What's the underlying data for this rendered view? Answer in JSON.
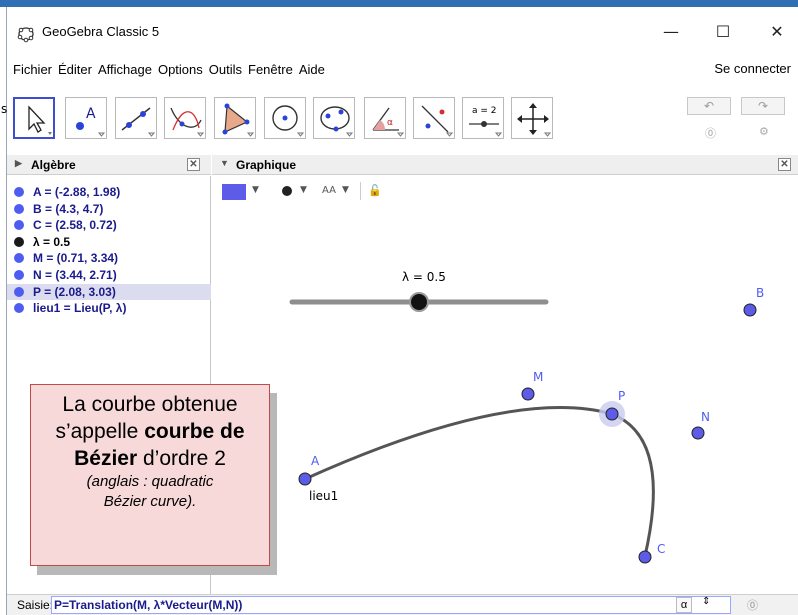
{
  "window": {
    "title": "GeoGebra Classic 5",
    "minimize": "—",
    "maximize": "☐",
    "close": "✕"
  },
  "menu": {
    "items": [
      "Fichier",
      "Éditer",
      "Affichage",
      "Options",
      "Outils",
      "Fenêtre",
      "Aide"
    ],
    "connect": "Se connecter"
  },
  "toolbar": {
    "value_tool_label": "a = 2",
    "undo_icon": "undo-icon",
    "redo_icon": "redo-icon",
    "help_icon": "help-icon",
    "settings_icon": "gear-icon"
  },
  "algebra": {
    "title": "Algèbre",
    "items": [
      {
        "text": "A = (-2.88, 1.98)",
        "color": "#4f5cf0",
        "highlight": false
      },
      {
        "text": "B = (4.3, 4.7)",
        "color": "#4f5cf0",
        "highlight": false
      },
      {
        "text": "C = (2.58, 0.72)",
        "color": "#4f5cf0",
        "highlight": false
      },
      {
        "text": "λ = 0.5",
        "color": "#1a1a1a",
        "highlight": false
      },
      {
        "text": "M = (0.71, 3.34)",
        "color": "#4f5cf0",
        "highlight": false
      },
      {
        "text": "N = (3.44, 2.71)",
        "color": "#4f5cf0",
        "highlight": false
      },
      {
        "text": "P = (2.08, 3.03)",
        "color": "#4f5cf0",
        "highlight": true
      },
      {
        "text": "lieu1 = Lieu(P, λ)",
        "color": "#4f5cf0",
        "highlight": false
      }
    ]
  },
  "graphics": {
    "title": "Graphique",
    "style_bar_text": "AA",
    "slider_label": "λ = 0.5",
    "points": {
      "A": "A",
      "B": "B",
      "C": "C",
      "M": "M",
      "N": "N",
      "P": "P",
      "locus": "lieu1"
    },
    "colors": {
      "point": "#5c5ce8",
      "curve": "#555555"
    }
  },
  "callout": {
    "line1": "La courbe obtenue",
    "line2_prefix": "s’appelle ",
    "line2_bold": "courbe de",
    "line3_bold": "Bézier",
    "line3_suffix": " d’ordre 2",
    "line4": "(anglais : quadratic",
    "line5": "Bézier curve)."
  },
  "input": {
    "label": "Saisie:",
    "value": "P=Translation(M, λ*Vecteur(M,N))",
    "alpha": "α",
    "updown": "⇕",
    "help": "?"
  },
  "stray": {
    "s": "s"
  }
}
